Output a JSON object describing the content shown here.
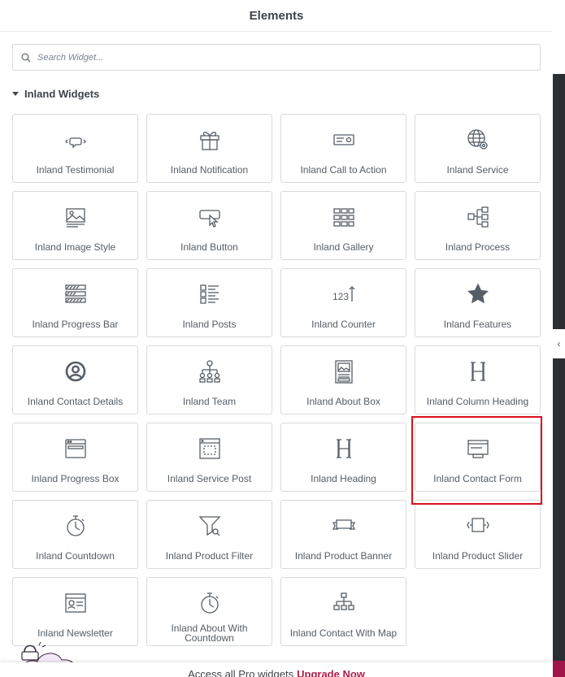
{
  "header": {
    "title": "Elements"
  },
  "search": {
    "placeholder": "Search Widget..."
  },
  "category": {
    "title": "Inland Widgets"
  },
  "widgets": [
    {
      "label": "Inland Testimonial",
      "icon": "testimonial-icon"
    },
    {
      "label": "Inland Notification",
      "icon": "gift-icon"
    },
    {
      "label": "Inland Call to Action",
      "icon": "call-to-action-icon"
    },
    {
      "label": "Inland Service",
      "icon": "globe-gear-icon"
    },
    {
      "label": "Inland Image Style",
      "icon": "image-icon"
    },
    {
      "label": "Inland Button",
      "icon": "button-pointer-icon"
    },
    {
      "label": "Inland Gallery",
      "icon": "gallery-grid-icon"
    },
    {
      "label": "Inland Process",
      "icon": "process-flow-icon"
    },
    {
      "label": "Inland Progress Bar",
      "icon": "progress-bars-icon"
    },
    {
      "label": "Inland Posts",
      "icon": "posts-list-icon"
    },
    {
      "label": "Inland Counter",
      "icon": "counter-icon"
    },
    {
      "label": "Inland Features",
      "icon": "star-icon"
    },
    {
      "label": "Inland Contact Details",
      "icon": "user-circle-icon"
    },
    {
      "label": "Inland Team",
      "icon": "team-tree-icon"
    },
    {
      "label": "Inland About Box",
      "icon": "about-box-icon"
    },
    {
      "label": "Inland Column Heading",
      "icon": "heading-h-icon"
    },
    {
      "label": "Inland Progress Box",
      "icon": "window-box-icon"
    },
    {
      "label": "Inland Service Post",
      "icon": "service-post-icon"
    },
    {
      "label": "Inland Heading",
      "icon": "heading-h-icon"
    },
    {
      "label": "Inland Contact Form",
      "icon": "contact-form-icon"
    },
    {
      "label": "Inland Countdown",
      "icon": "stopwatch-icon"
    },
    {
      "label": "Inland Product Filter",
      "icon": "filter-icon"
    },
    {
      "label": "Inland Product Banner",
      "icon": "banner-ribbon-icon"
    },
    {
      "label": "Inland Product Slider",
      "icon": "slider-icon"
    },
    {
      "label": "Inland Newsletter",
      "icon": "newsletter-icon"
    },
    {
      "label": "Inland About With Countdown",
      "icon": "stopwatch-icon"
    },
    {
      "label": "Inland Contact With Map",
      "icon": "sitemap-icon"
    }
  ],
  "promo": {
    "text": "Access all Pro widgets",
    "link": "Upgrade Now"
  },
  "colors": {
    "highlight": "#d9111b",
    "upgrade": "#b01b4b",
    "sidebar_dark": "#2b2f33"
  }
}
